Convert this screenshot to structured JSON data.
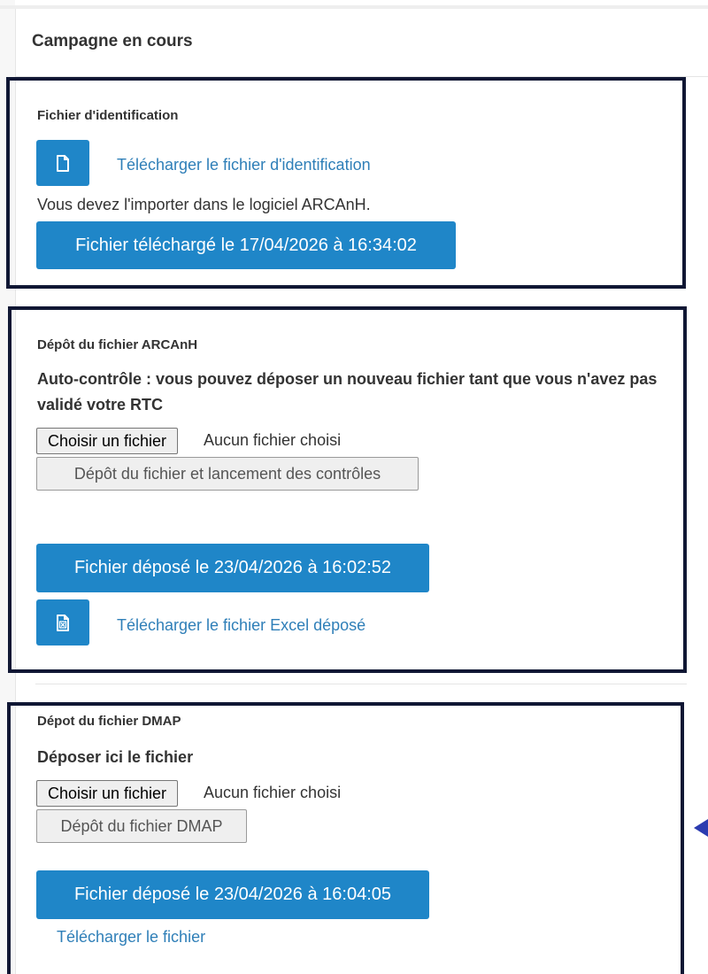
{
  "panel": {
    "title": "Campagne en cours"
  },
  "identification": {
    "title": "Fichier d'identification",
    "download_link": "Télécharger le fichier d'identification",
    "note": "Vous devez l'importer dans le logiciel ARCAnH.",
    "status_button": "Fichier téléchargé le 17/04/2026 à 16:34:02",
    "icon": "file-icon"
  },
  "arcanh": {
    "title": "Dépôt du fichier ARCAnH",
    "instruction": "Auto-contrôle : vous pouvez déposer un nouveau fichier tant que vous n'avez pas validé votre RTC",
    "choose_file_button": "Choisir un fichier",
    "no_file_text": "Aucun fichier choisi",
    "submit_button": "Dépôt du fichier et lancement des contrôles",
    "status_button": "Fichier déposé le 23/04/2026 à 16:02:52",
    "download_link": "Télécharger le fichier Excel déposé",
    "icon": "excel-file-icon"
  },
  "dmap": {
    "title": "Dépot du fichier DMAP",
    "instruction": "Déposer ici le fichier",
    "choose_file_button": "Choisir un fichier",
    "no_file_text": "Aucun fichier choisi",
    "submit_button": "Dépôt du fichier DMAP",
    "status_button": "Fichier déposé le 23/04/2026 à 16:04:05",
    "download_link": "Télécharger le fichier"
  },
  "colors": {
    "primary": "#1f86c8",
    "link": "#2f7fb8",
    "box_border": "#101734",
    "arrow": "#2b3bb0"
  }
}
